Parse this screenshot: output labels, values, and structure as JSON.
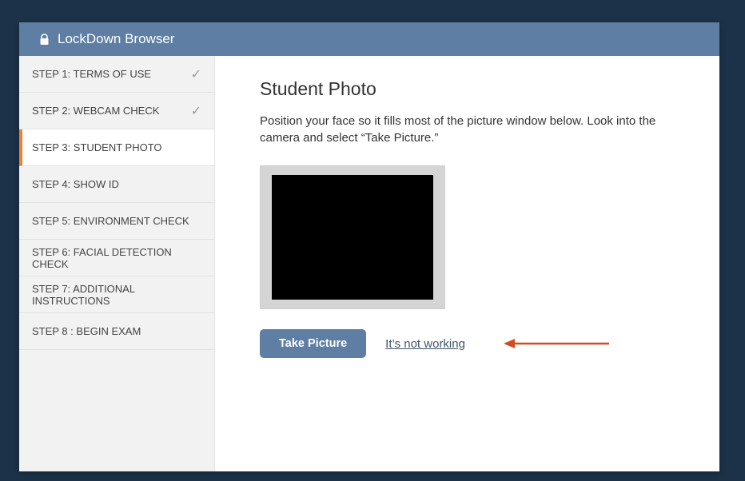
{
  "header": {
    "title": "LockDown Browser"
  },
  "sidebar": {
    "items": [
      {
        "label": "STEP 1: TERMS OF USE",
        "completed": true,
        "active": false
      },
      {
        "label": "STEP 2: WEBCAM CHECK",
        "completed": true,
        "active": false
      },
      {
        "label": "STEP 3: STUDENT PHOTO",
        "completed": false,
        "active": true
      },
      {
        "label": "STEP 4: SHOW ID",
        "completed": false,
        "active": false
      },
      {
        "label": "STEP 5: ENVIRONMENT CHECK",
        "completed": false,
        "active": false
      },
      {
        "label": "STEP 6: FACIAL DETECTION CHECK",
        "completed": false,
        "active": false
      },
      {
        "label": "STEP 7: ADDITIONAL INSTRUCTIONS",
        "completed": false,
        "active": false
      },
      {
        "label": "STEP 8 : BEGIN EXAM",
        "completed": false,
        "active": false
      }
    ]
  },
  "main": {
    "heading": "Student Photo",
    "instructions": "Position your face so it fills most of the picture window below. Look into the camera and select “Take Picture.”",
    "take_picture_label": "Take Picture",
    "not_working_label": "It’s not working"
  },
  "colors": {
    "titlebar": "#5e7ea3",
    "sidebar_bg": "#f2f2f2",
    "active_accent": "#f08030",
    "button_bg": "#5e7ea3",
    "link": "#41566d",
    "arrow": "#d34b1f"
  }
}
